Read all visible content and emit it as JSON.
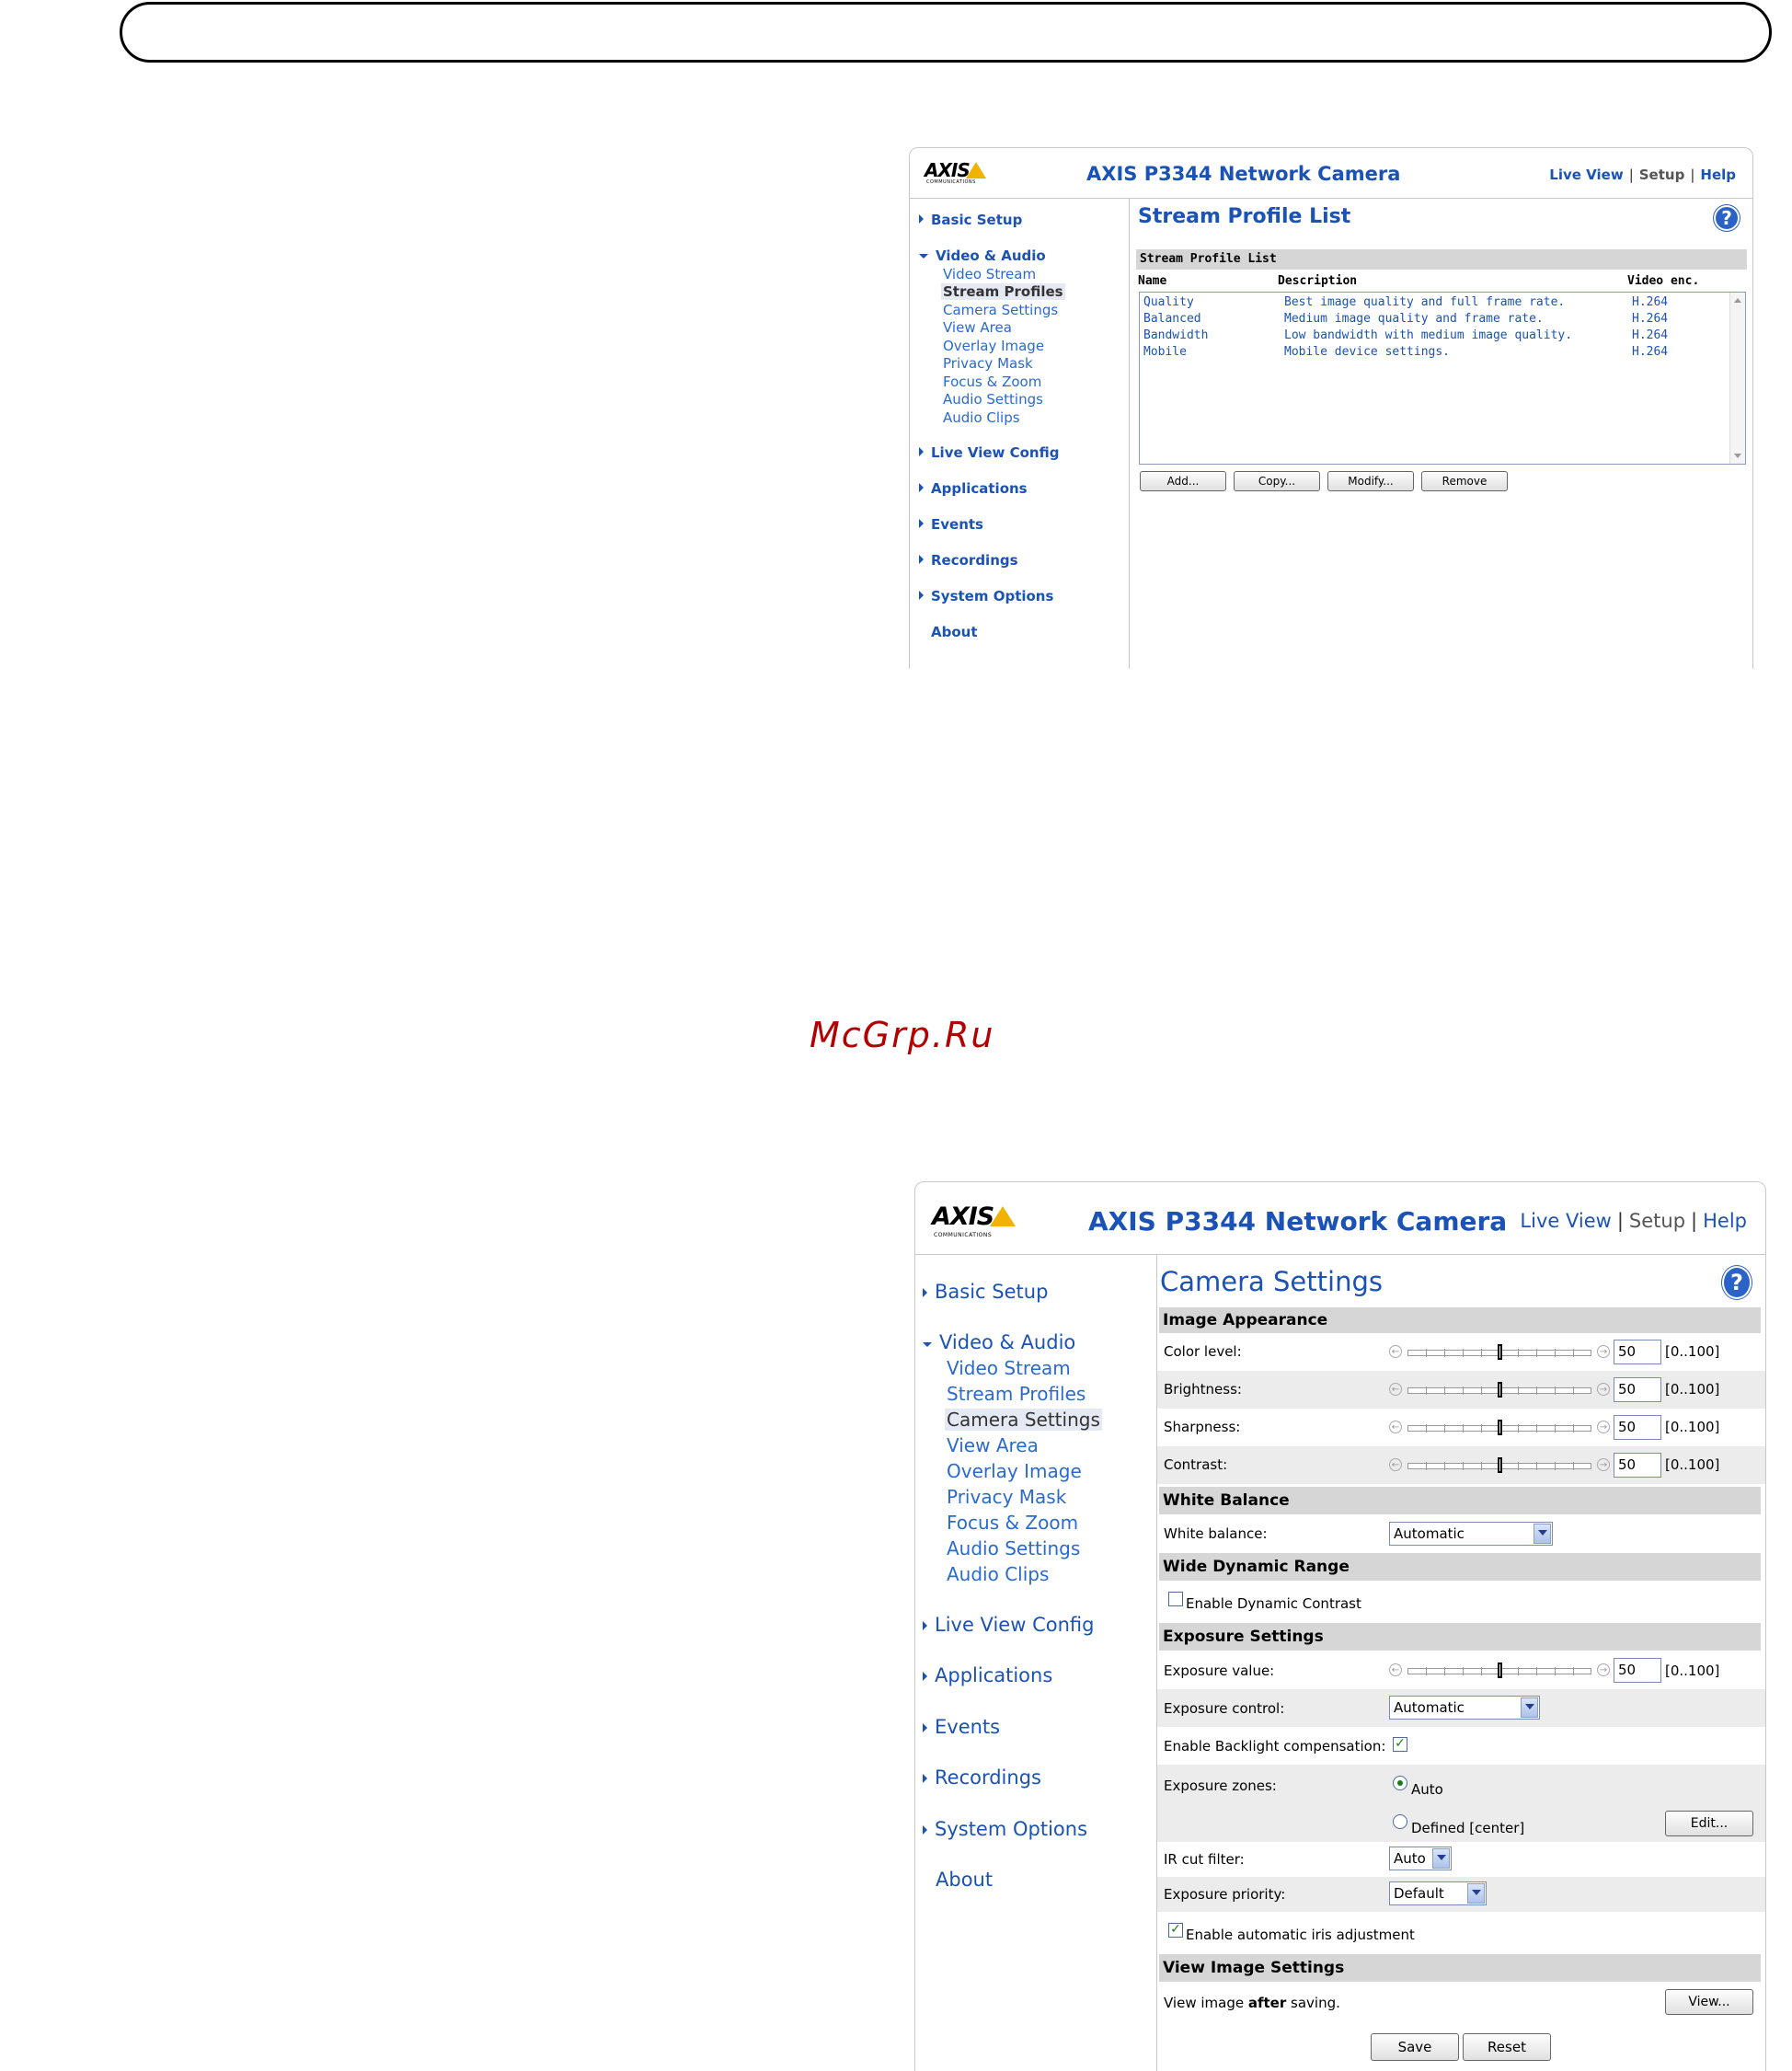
{
  "brand": {
    "accent": "#1a52b5",
    "logo_text": "AXIS",
    "logo_sub": "COMMUNICATIONS"
  },
  "watermark": "McGrp.Ru",
  "screen1": {
    "product": "AXIS P3344 Network Camera",
    "links": {
      "live_view": "Live View",
      "setup": "Setup",
      "help": "Help",
      "sep": "|"
    },
    "nav": {
      "basic_setup": "Basic Setup",
      "video_audio": "Video & Audio",
      "subitems": [
        "Video Stream",
        "Stream Profiles",
        "Camera Settings",
        "View Area",
        "Overlay Image",
        "Privacy Mask",
        "Focus & Zoom",
        "Audio Settings",
        "Audio Clips"
      ],
      "live_view_config": "Live View Config",
      "applications": "Applications",
      "events": "Events",
      "recordings": "Recordings",
      "system_options": "System Options",
      "about": "About"
    },
    "title": "Stream Profile List",
    "help_icon": "?",
    "section": "Stream Profile List",
    "columns": {
      "name": "Name",
      "description": "Description",
      "video_enc": "Video enc."
    },
    "profiles": [
      {
        "name": "Quality",
        "description": "Best image quality and full frame rate.",
        "enc": "H.264"
      },
      {
        "name": "Balanced",
        "description": "Medium image quality and frame rate.",
        "enc": "H.264"
      },
      {
        "name": "Bandwidth",
        "description": "Low bandwidth with medium image quality.",
        "enc": "H.264"
      },
      {
        "name": "Mobile",
        "description": "Mobile device settings.",
        "enc": "H.264"
      }
    ],
    "buttons": {
      "add": "Add...",
      "copy": "Copy...",
      "modify": "Modify...",
      "remove": "Remove"
    }
  },
  "screen2": {
    "product": "AXIS P3344 Network Camera",
    "links": {
      "live_view": "Live View",
      "setup": "Setup",
      "help": "Help",
      "sep": "|"
    },
    "title": "Camera Settings",
    "help_icon": "?",
    "image_appearance": {
      "header": "Image Appearance",
      "range": "[0..100]",
      "sliders": [
        {
          "label": "Color level:",
          "value": 50
        },
        {
          "label": "Brightness:",
          "value": 50
        },
        {
          "label": "Sharpness:",
          "value": 50
        },
        {
          "label": "Contrast:",
          "value": 50
        }
      ]
    },
    "white_balance": {
      "header": "White Balance",
      "label": "White balance:",
      "value": "Automatic"
    },
    "wdr": {
      "header": "Wide Dynamic Range",
      "label": "Enable Dynamic Contrast",
      "checked": false
    },
    "exposure": {
      "header": "Exposure Settings",
      "value_label": "Exposure value:",
      "value": 50,
      "range": "[0..100]",
      "control_label": "Exposure control:",
      "control_value": "Automatic",
      "backlight_label": "Enable Backlight compensation:",
      "backlight_checked": true,
      "zones_label": "Exposure zones:",
      "zone_auto": "Auto",
      "zone_defined": "Defined [center]",
      "edit_button": "Edit...",
      "ir_label": "IR cut filter:",
      "ir_value": "Auto",
      "priority_label": "Exposure priority:",
      "priority_value": "Default",
      "iris_label": "Enable automatic iris adjustment",
      "iris_checked": true
    },
    "view_image": {
      "header": "View Image Settings",
      "text_before": "View image ",
      "text_bold": "after",
      "text_after": " saving.",
      "view_button": "View..."
    },
    "buttons": {
      "save": "Save",
      "reset": "Reset"
    },
    "checkmark": "✓"
  }
}
